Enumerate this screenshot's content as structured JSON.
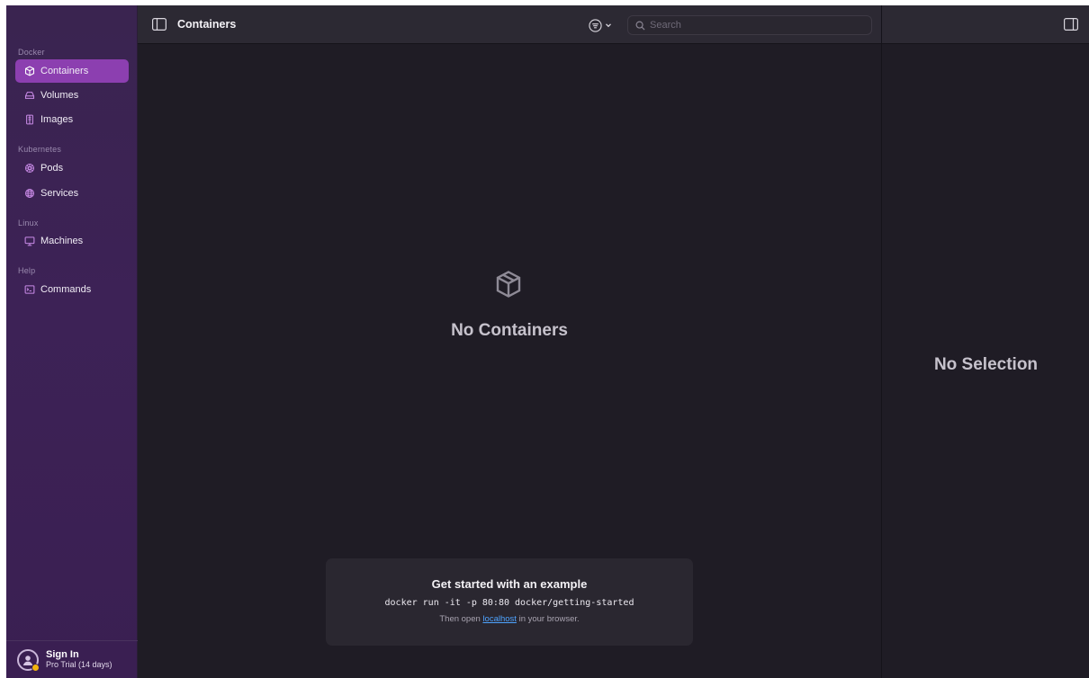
{
  "sidebar": {
    "sections": [
      {
        "label": "Docker",
        "items": [
          {
            "label": "Containers",
            "icon": "box-icon",
            "active": true
          },
          {
            "label": "Volumes",
            "icon": "drive-icon"
          },
          {
            "label": "Images",
            "icon": "image-layers-icon"
          }
        ]
      },
      {
        "label": "Kubernetes",
        "items": [
          {
            "label": "Pods",
            "icon": "pod-icon"
          },
          {
            "label": "Services",
            "icon": "globe-icon"
          }
        ]
      },
      {
        "label": "Linux",
        "items": [
          {
            "label": "Machines",
            "icon": "monitor-icon"
          }
        ]
      },
      {
        "label": "Help",
        "items": [
          {
            "label": "Commands",
            "icon": "terminal-icon"
          }
        ]
      }
    ],
    "user": {
      "name": "Sign In",
      "status": "Pro Trial (14 days)"
    }
  },
  "toolbar": {
    "title": "Containers",
    "search_placeholder": "Search"
  },
  "main": {
    "empty_title": "No Containers",
    "example": {
      "title": "Get started with an example",
      "command": "docker run -it -p 80:80 docker/getting-started",
      "note_before": "Then open ",
      "note_link": "localhost",
      "note_after": " in your browser."
    }
  },
  "detail": {
    "empty_title": "No Selection"
  },
  "colors": {
    "accent": "#8c3fb0",
    "link": "#4ea3ff",
    "trial_badge": "#f2b40e"
  }
}
